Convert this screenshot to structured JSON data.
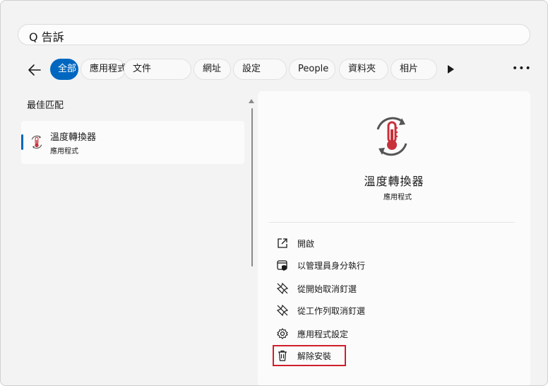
{
  "search": {
    "query": "Q 告訴"
  },
  "tabs": [
    {
      "label": "全部",
      "active": true
    },
    {
      "label": "應用程式"
    },
    {
      "label": "文件"
    },
    {
      "label": "網址"
    },
    {
      "label": "設定"
    },
    {
      "label": "People"
    },
    {
      "label": "資料夾"
    },
    {
      "label": "相片"
    }
  ],
  "results": {
    "section_title": "最佳匹配",
    "items": [
      {
        "name": "溫度轉換器",
        "type": "應用程式"
      }
    ]
  },
  "detail": {
    "title": "溫度轉換器",
    "type": "應用程式",
    "actions": [
      {
        "label": "開啟",
        "icon": "open-external-icon"
      },
      {
        "label": "以管理員身分執行",
        "icon": "admin-shield-icon"
      },
      {
        "label": "從開始取消釘選",
        "icon": "unpin-icon"
      },
      {
        "label": "從工作列取消釘選",
        "icon": "unpin-icon"
      },
      {
        "label": "應用程式設定",
        "icon": "gear-icon"
      },
      {
        "label": "解除安裝",
        "icon": "trash-icon"
      }
    ]
  },
  "colors": {
    "accent": "#0067c0",
    "highlight": "#d01f2b",
    "icon_red": "#c8313a"
  }
}
